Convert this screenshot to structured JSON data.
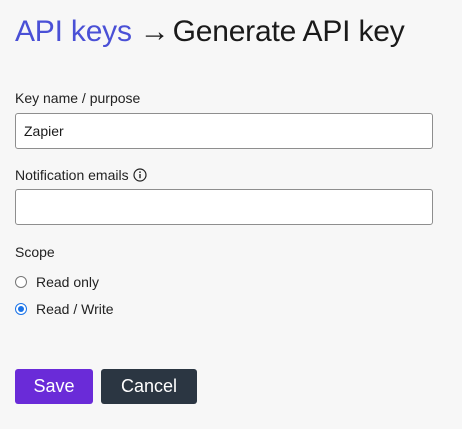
{
  "breadcrumb": {
    "parent_label": "API keys",
    "separator": "→",
    "current_label": "Generate API key"
  },
  "form": {
    "key_name": {
      "label": "Key name / purpose",
      "value": "Zapier",
      "placeholder": ""
    },
    "notification_emails": {
      "label": "Notification emails",
      "value": "",
      "placeholder": "",
      "icon": "info-icon"
    },
    "scope": {
      "label": "Scope",
      "options": [
        {
          "label": "Read only",
          "checked": false
        },
        {
          "label": "Read / Write",
          "checked": true
        }
      ]
    }
  },
  "actions": {
    "save_label": "Save",
    "cancel_label": "Cancel"
  },
  "colors": {
    "link": "#4a50d6",
    "save_button": "#6a2bd8",
    "cancel_button": "#2b3642",
    "radio_checked": "#1a73e8",
    "background": "#f7f7f7"
  }
}
